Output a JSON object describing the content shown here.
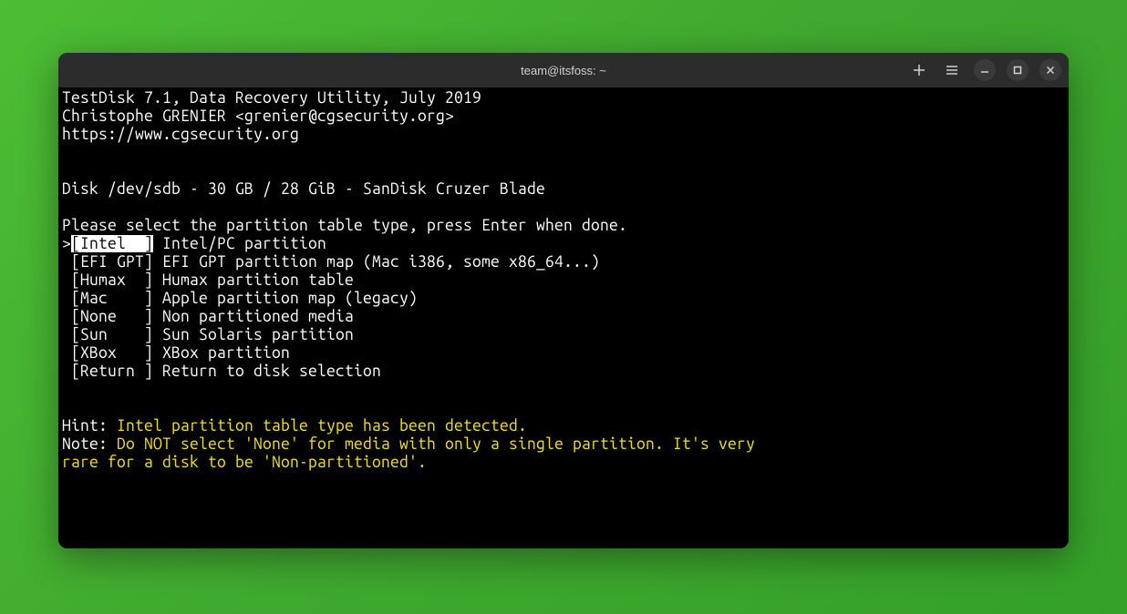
{
  "titlebar": {
    "title": "team@itsfoss: ~"
  },
  "header": {
    "line1": "TestDisk 7.1, Data Recovery Utility, July 2019",
    "line2": "Christophe GRENIER <grenier@cgsecurity.org>",
    "line3": "https://www.cgsecurity.org"
  },
  "disk_line": "Disk /dev/sdb - 30 GB / 28 GiB - SanDisk Cruzer Blade",
  "prompt_line": "Please select the partition table type, press Enter when done.",
  "menu": {
    "selected": {
      "prefix": ">",
      "label": "[Intel  ]",
      "desc": " Intel/PC partition"
    },
    "items": [
      {
        "label": " [EFI GPT]",
        "desc": " EFI GPT partition map (Mac i386, some x86_64...)"
      },
      {
        "label": " [Humax  ]",
        "desc": " Humax partition table"
      },
      {
        "label": " [Mac    ]",
        "desc": " Apple partition map (legacy)"
      },
      {
        "label": " [None   ]",
        "desc": " Non partitioned media"
      },
      {
        "label": " [Sun    ]",
        "desc": " Sun Solaris partition"
      },
      {
        "label": " [XBox   ]",
        "desc": " XBox partition"
      },
      {
        "label": " [Return ]",
        "desc": " Return to disk selection"
      }
    ]
  },
  "hint": {
    "prefix": "Hint: ",
    "detected": "Intel",
    "rest": " partition table type has been detected."
  },
  "note": {
    "prefix": "Note: ",
    "line1": "Do NOT select 'None' for media with only a single partition. It's very",
    "line2": "rare for a disk to be 'Non-partitioned'."
  }
}
